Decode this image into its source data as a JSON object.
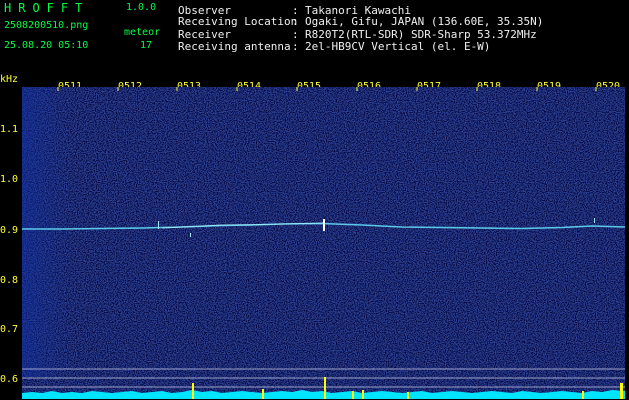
{
  "app": {
    "title": "HROFFT",
    "version": "1.0.0",
    "file_name": "2508200510.png",
    "timestamp": "25.08.20 05:10",
    "mode_label": "meteor",
    "count": "17"
  },
  "info": [
    {
      "label": "Observer",
      "value": "Takanori Kawachi"
    },
    {
      "label": "Receiving Location",
      "value": "Ogaki, Gifu, JAPAN (136.60E, 35.35N)"
    },
    {
      "label": "Receiver",
      "value": "R820T2(RTL-SDR) SDR-Sharp 53.372MHz"
    },
    {
      "label": "Receiving antenna",
      "value": "2el-HB9CV Vertical (el. E-W)"
    }
  ],
  "axis": {
    "y_unit": "kHz",
    "y_ticks": [
      "1.1",
      "1.0",
      "0.9",
      "0.8",
      "0.7",
      "0.6"
    ],
    "x_ticks": [
      "0511",
      "0512",
      "0513",
      "0514",
      "0515",
      "0516",
      "0517",
      "0518",
      "0519",
      "0520"
    ]
  },
  "colors": {
    "background": "#000000",
    "spectrogram_base": "#00003a",
    "signal_line": "#66e8ff",
    "level_bar": "#00e5ff",
    "ping_marker": "#ffff00",
    "header_text": "#00ff44",
    "tick_text": "#ffff33"
  }
}
